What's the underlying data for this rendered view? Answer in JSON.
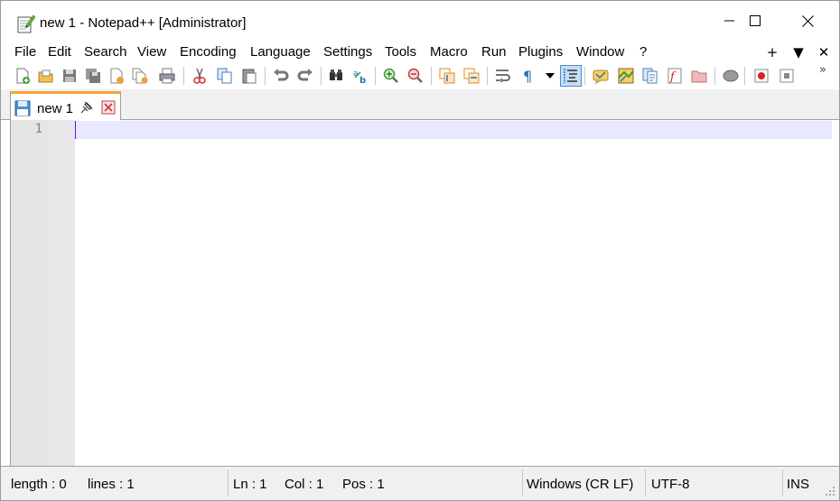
{
  "window": {
    "title": "new 1 - Notepad++ [Administrator]",
    "icon": "notepad-icon"
  },
  "menu": {
    "items": [
      "File",
      "Edit",
      "Search",
      "View",
      "Encoding",
      "Language",
      "Settings",
      "Tools",
      "Macro",
      "Run",
      "Plugins",
      "Window",
      "?"
    ],
    "right": [
      "+",
      "▼",
      "✕"
    ]
  },
  "toolbar": {
    "icons": [
      "new-file-icon",
      "open-file-icon",
      "save-icon",
      "save-all-icon",
      "close-icon",
      "close-all-icon",
      "print-icon",
      "cut-icon",
      "copy-icon",
      "paste-icon",
      "undo-icon",
      "redo-icon",
      "find-icon",
      "replace-icon",
      "zoom-in-icon",
      "zoom-out-icon",
      "sync-vertical-icon",
      "sync-horizontal-icon",
      "word-wrap-icon",
      "show-all-characters-icon",
      "indent-guide-icon",
      "user-defined-language-icon",
      "document-map-icon",
      "document-list-icon",
      "function-list-icon",
      "folder-as-workspace-icon",
      "monitoring-icon",
      "record-macro-icon",
      "stop-record-icon"
    ],
    "more": "»"
  },
  "tabs": [
    {
      "label": "new 1",
      "pin_icon": "pin-icon",
      "close_icon": "close-tab-icon"
    }
  ],
  "editor": {
    "line_numbers": [
      "1"
    ],
    "content": ""
  },
  "status": {
    "length": "length : 0",
    "lines": "lines : 1",
    "ln": "Ln : 1",
    "col": "Col : 1",
    "pos": "Pos : 1",
    "eol": "Windows (CR LF)",
    "encoding": "UTF-8",
    "mode": "INS"
  },
  "colors": {
    "tab_accent": "#f7a33b",
    "current_line": "#e8e8ff",
    "caret": "#8000ff",
    "active_toolbar": "#c7ddf2"
  }
}
